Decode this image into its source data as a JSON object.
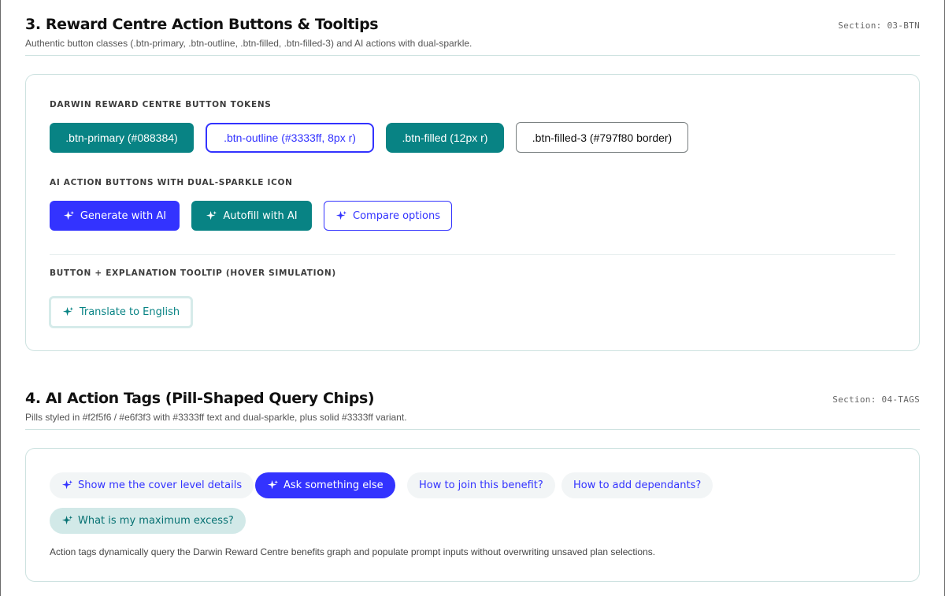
{
  "section3": {
    "title": "3. Reward Centre Action Buttons & Tooltips",
    "subtitle": "Authentic button classes (.btn-primary, .btn-outline, .btn-filled, .btn-filled-3) and AI actions with dual-sparkle.",
    "code": "Section: 03-BTN",
    "tokens_label": "DARWIN REWARD CENTRE BUTTON TOKENS",
    "tokens": [
      {
        "label": ".btn-primary (#088384)"
      },
      {
        "label": ".btn-outline (#3333ff, 8px r)"
      },
      {
        "label": ".btn-filled (12px r)"
      },
      {
        "label": ".btn-filled-3 (#797f80 border)"
      }
    ],
    "ai_label": "AI ACTION BUTTONS WITH DUAL-SPARKLE ICON",
    "ai_buttons": [
      {
        "label": "Generate with AI",
        "icon": "sparkle-icon"
      },
      {
        "label": "Autofill with AI",
        "icon": "sparkle-icon"
      },
      {
        "label": "Compare options",
        "icon": "sparkle-icon"
      }
    ],
    "tooltip_label": "BUTTON + EXPLANATION TOOLTIP (HOVER SIMULATION)",
    "translate_button": {
      "label": "Translate to English",
      "icon": "sparkle-icon"
    }
  },
  "section4": {
    "title": "4. AI Action Tags (Pill-Shaped Query Chips)",
    "subtitle": "Pills styled in #f2f5f6 / #e6f3f3 with #3333ff text and dual-sparkle, plus solid #3333ff variant.",
    "code": "Section: 04-TAGS",
    "tags": [
      {
        "label": "Show me the cover level details"
      },
      {
        "label": "Ask something else"
      },
      {
        "label": "How to join this benefit?"
      },
      {
        "label": "How to add dependants?"
      },
      {
        "label": "What is my maximum excess?"
      }
    ],
    "note": "Action tags dynamically query the Darwin Reward Centre benefits graph and populate prompt inputs without overwriting unsaved plan selections."
  },
  "colors": {
    "teal": "#088384",
    "blue": "#3333ff",
    "grey_border": "#797f80",
    "pill_light": "#f2f5f6",
    "pill_teal": "#e6f3f3"
  }
}
